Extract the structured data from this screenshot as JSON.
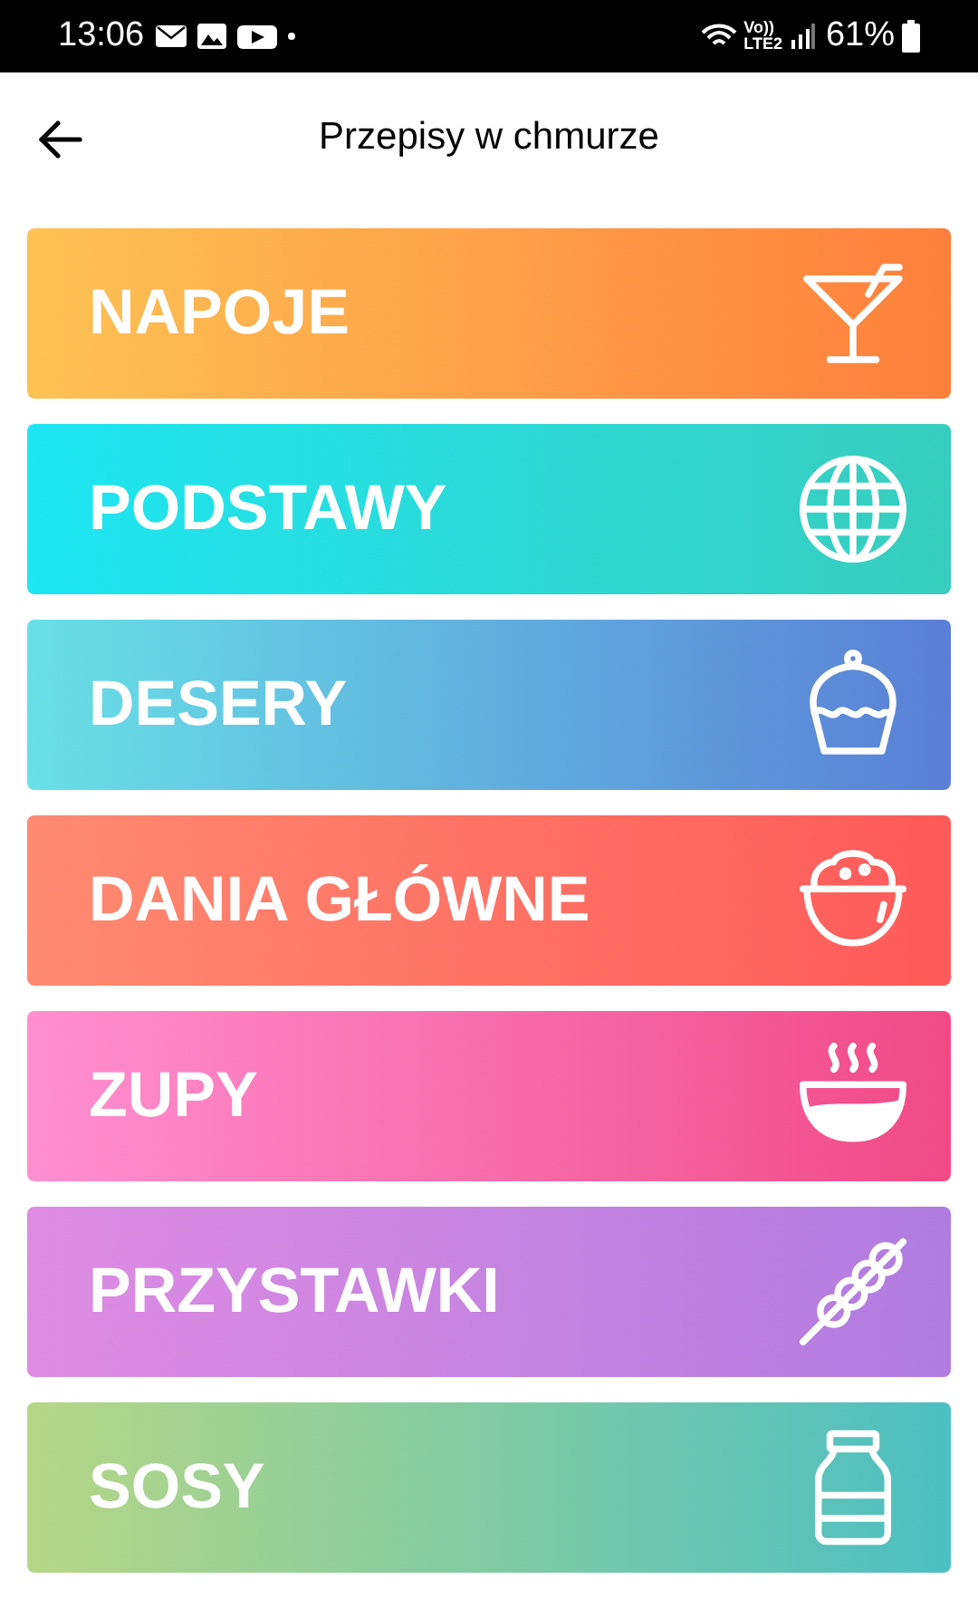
{
  "status_bar": {
    "time": "13:06",
    "network_top": "Vo))",
    "network_bottom": "LTE2",
    "battery": "61%"
  },
  "header": {
    "title": "Przepisy w chmurze"
  },
  "categories": [
    {
      "label": "NAPOJE",
      "kind": "cocktail",
      "gradient": [
        {
          "color": "#fdc254"
        },
        {
          "color": "#fe7f3c"
        }
      ]
    },
    {
      "label": "PODSTAWY",
      "kind": "globe",
      "gradient": [
        {
          "color": "#1ee6f2"
        },
        {
          "color": "#38cdbd"
        }
      ]
    },
    {
      "label": "DESERY",
      "kind": "cupcake",
      "gradient": [
        {
          "color": "#68e0e6"
        },
        {
          "color": "#5a7fd6"
        }
      ]
    },
    {
      "label": "DANIA GŁÓWNE",
      "kind": "rice",
      "gradient": [
        {
          "color": "#fe8a70"
        },
        {
          "color": "#fe5a5a"
        }
      ]
    },
    {
      "label": "ZUPY",
      "kind": "soup",
      "gradient": [
        {
          "color": "#ff8fd0"
        },
        {
          "color": "#f04a85"
        }
      ]
    },
    {
      "label": "PRZYSTAWKI",
      "kind": "skewer",
      "gradient": [
        {
          "color": "#de8ce2"
        },
        {
          "color": "#b07ce0"
        }
      ]
    },
    {
      "label": "SOSY",
      "kind": "jar",
      "gradient": [
        {
          "color": "#b6d686"
        },
        {
          "color": "#4cbfc2"
        }
      ]
    }
  ]
}
